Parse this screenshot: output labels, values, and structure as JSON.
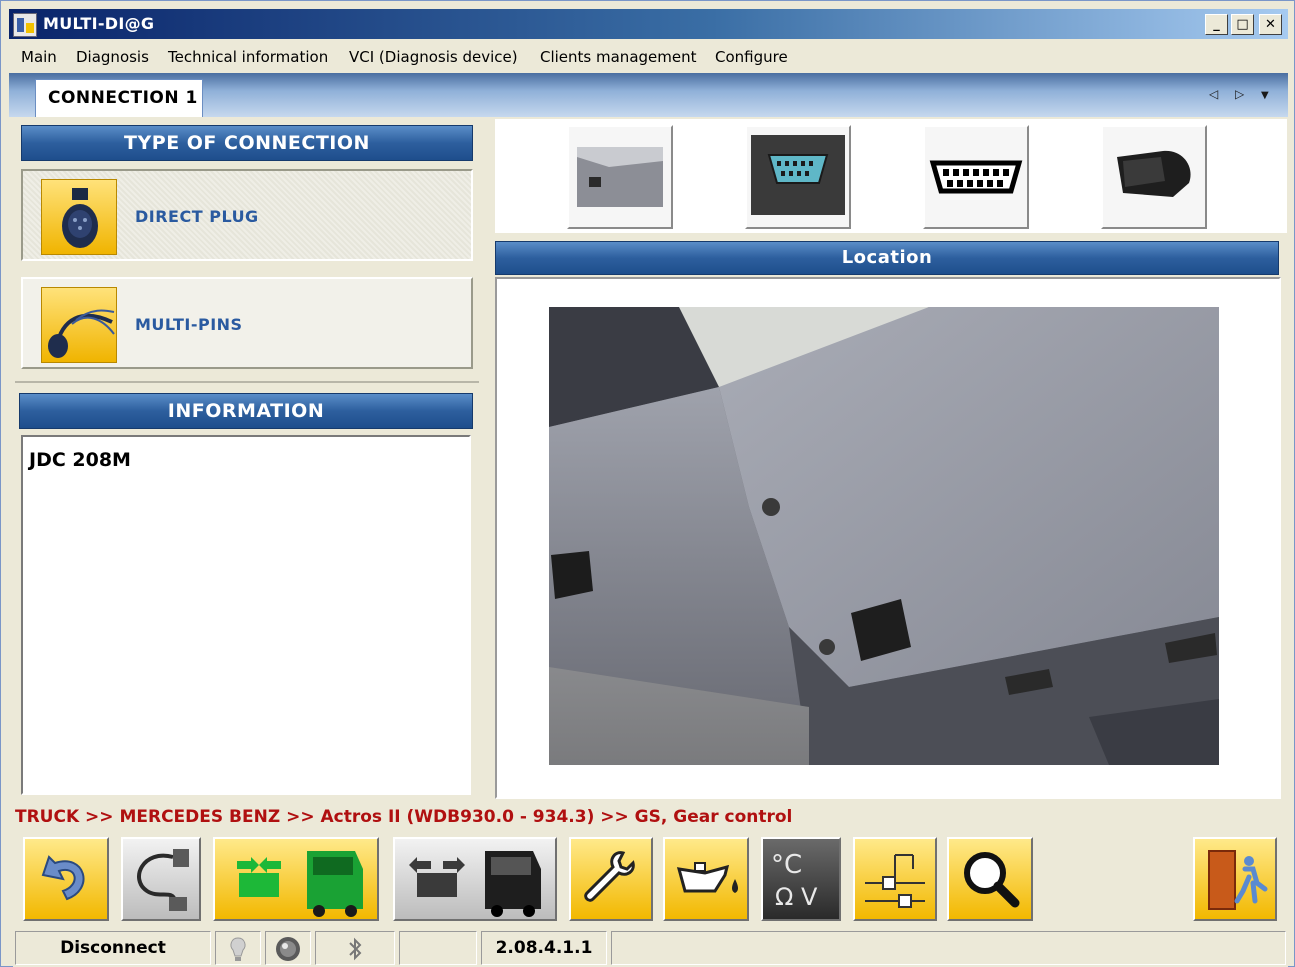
{
  "window": {
    "title": "MULTI-DI@G",
    "minimize_label": "_",
    "maximize_label": "□",
    "close_label": "✕"
  },
  "menu": {
    "items": [
      {
        "label": "Main"
      },
      {
        "label": "Diagnosis"
      },
      {
        "label": "Technical information"
      },
      {
        "label": "VCI (Diagnosis device)"
      },
      {
        "label": "Clients management"
      },
      {
        "label": "Configure"
      }
    ]
  },
  "tabs": {
    "active_label": "CONNECTION 1",
    "prev_icon": "◁",
    "next_icon": "▷",
    "dropdown_icon": "▼"
  },
  "connection_type": {
    "header": "TYPE OF CONNECTION",
    "options": [
      {
        "label": "DIRECT PLUG",
        "icon": "round-plug-icon",
        "selected": true
      },
      {
        "label": "MULTI-PINS",
        "icon": "multi-pins-cable-icon",
        "selected": false
      }
    ]
  },
  "information": {
    "header": "INFORMATION",
    "text": "JDC 208M"
  },
  "thumbnails": [
    {
      "name": "dashboard-location-thumbnail"
    },
    {
      "name": "obd-socket-thumbnail"
    },
    {
      "name": "obd-connector-diagram-thumbnail"
    },
    {
      "name": "obd-plug-thumbnail"
    }
  ],
  "location": {
    "header": "Location",
    "image": "diagnostic-socket-location-photo"
  },
  "breadcrumb": "TRUCK >> MERCEDES BENZ >> Actros II (WDB930.0 - 934.3) >> GS, Gear control",
  "toolbar": {
    "buttons": [
      {
        "name": "back-button",
        "icon": "undo-arrow-icon"
      },
      {
        "name": "cable-button",
        "icon": "cable-icon"
      },
      {
        "name": "connect-vehicle-button",
        "icon": "connect-truck-icon"
      },
      {
        "name": "disconnect-vehicle-button",
        "icon": "disconnect-truck-icon"
      },
      {
        "name": "maintenance-button",
        "icon": "wrench-icon"
      },
      {
        "name": "oil-service-button",
        "icon": "oil-can-icon"
      },
      {
        "name": "measurement-button",
        "icon": "temperature-ohm-voltage-icon"
      },
      {
        "name": "wiring-diagram-button",
        "icon": "wiring-diagram-icon"
      },
      {
        "name": "search-button",
        "icon": "magnifier-icon"
      },
      {
        "name": "exit-button",
        "icon": "exit-door-icon"
      }
    ],
    "measurement_text": {
      "line1": "°C",
      "line2": "Ω V"
    }
  },
  "status": {
    "disconnect_label": "Disconnect",
    "version": "2.08.4.1.1",
    "icons": [
      "lamp-icon",
      "led-indicator-icon",
      "bluetooth-icon"
    ]
  },
  "colors": {
    "title_bar_start": "#0a246a",
    "header_blue": "#2d5f9e",
    "accent_yellow": "#f2b800",
    "breadcrumb_red": "#b01010",
    "option_label_blue": "#2a5aa0"
  }
}
